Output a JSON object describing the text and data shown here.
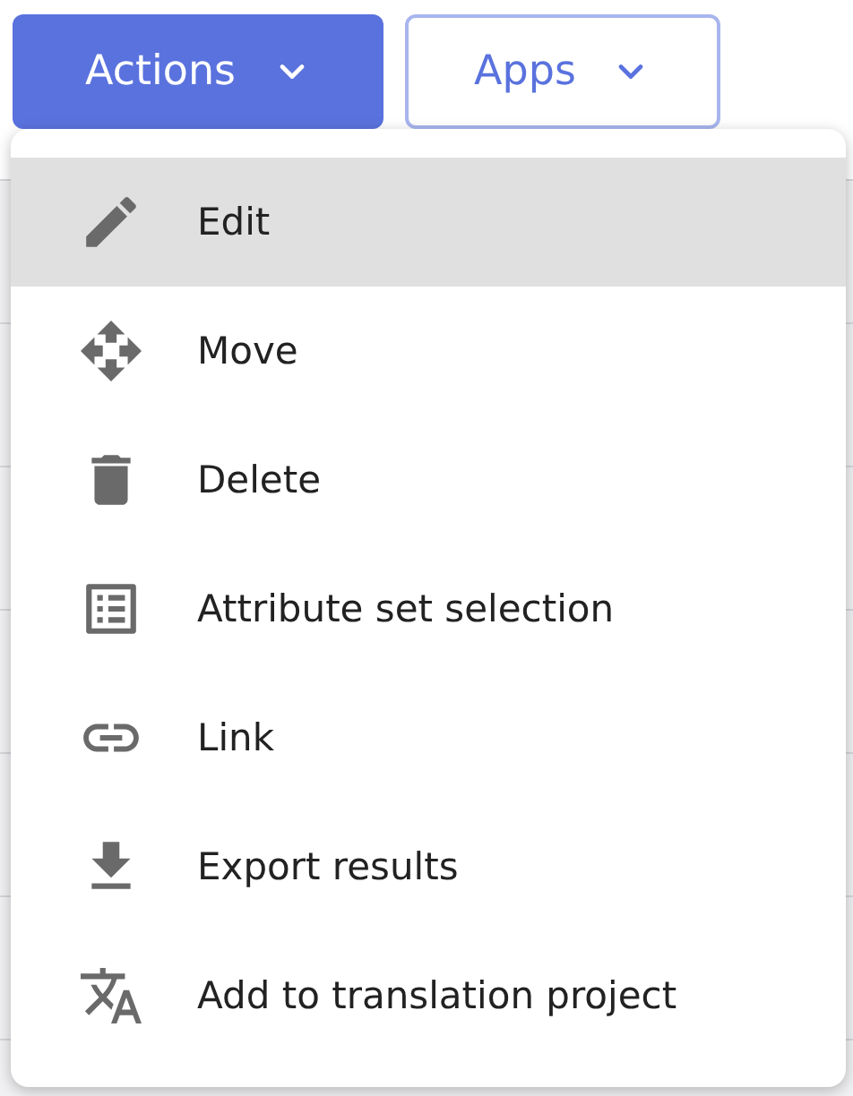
{
  "toolbar": {
    "buttons": [
      {
        "label": "Actions",
        "kind": "primary"
      },
      {
        "label": "Apps",
        "kind": "outline"
      }
    ]
  },
  "menu": {
    "items": [
      {
        "label": "Edit",
        "kind": "edit",
        "selected": true
      },
      {
        "label": "Move",
        "kind": "move",
        "selected": false
      },
      {
        "label": "Delete",
        "kind": "delete",
        "selected": false
      },
      {
        "label": "Attribute set selection",
        "kind": "list",
        "selected": false
      },
      {
        "label": "Link",
        "kind": "link",
        "selected": false
      },
      {
        "label": "Export results",
        "kind": "download",
        "selected": false
      },
      {
        "label": "Add to translation project",
        "kind": "translate",
        "selected": false
      }
    ]
  }
}
